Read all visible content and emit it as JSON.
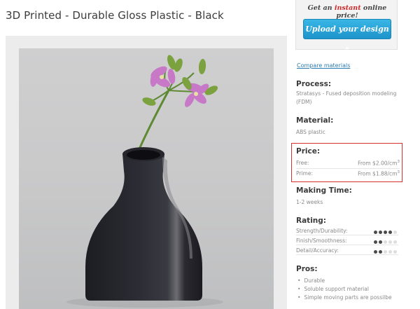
{
  "product": {
    "title": "3D Printed - Durable Gloss Plastic - Black"
  },
  "upload": {
    "tagline_prefix": "Get an",
    "tagline_highlight": "instant",
    "tagline_suffix": "online price!",
    "button_label": "Upload your design »",
    "accent_color": "#2aa7dd",
    "highlight_color": "#cc2a2a"
  },
  "compare_link": "Compare materials",
  "process": {
    "heading": "Process:",
    "text": "Stratasys - Fused deposition modeling (FDM)"
  },
  "material": {
    "heading": "Material:",
    "text": "ABS plastic"
  },
  "price": {
    "heading": "Price:",
    "border_color": "#d9302c",
    "rows": [
      {
        "label": "Free:",
        "value": "From $2.00/cm",
        "sup": "3"
      },
      {
        "label": "Prime:",
        "value": "From $1.88/cm",
        "sup": "3"
      }
    ]
  },
  "making_time": {
    "heading": "Making Time:",
    "text": "1-2 weeks"
  },
  "rating": {
    "heading": "Rating:",
    "rows": [
      {
        "label": "Strength/Durability:",
        "score": 4,
        "max": 5
      },
      {
        "label": "Finish/Smoothness:",
        "score": 2,
        "max": 5
      },
      {
        "label": "Detail/Accuracy:",
        "score": 2,
        "max": 5
      }
    ]
  },
  "pros": {
    "heading": "Pros:",
    "items": [
      "Durable",
      "Soluble support material",
      "Simple moving parts are possilbe"
    ]
  }
}
